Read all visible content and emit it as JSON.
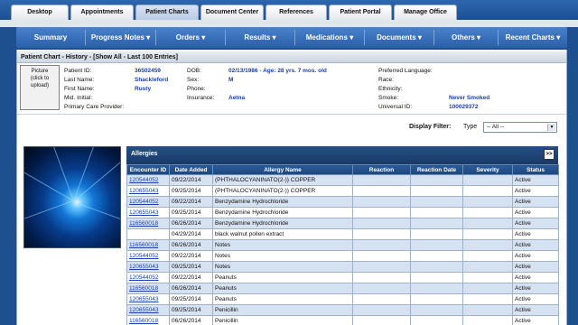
{
  "tabs": [
    "Desktop",
    "Appointments",
    "Patient Charts",
    "Document Center",
    "References",
    "Patient Portal",
    "Manage Office"
  ],
  "active_tab": "Patient Charts",
  "menu": [
    "Summary",
    "Progress Notes ▾",
    "Orders ▾",
    "Results ▾",
    "Medications ▾",
    "Documents ▾",
    "Others ▾",
    "Recent Charts ▾"
  ],
  "chart_title": "Patient Chart - History - [Show All - Last 100 Entries]",
  "picture": {
    "line1": "Picture",
    "line2": "(click to",
    "line3": "upload)"
  },
  "patient": {
    "id_label": "Patient ID:",
    "id": "36502459",
    "last_label": "Last Name:",
    "last": "Shackleford",
    "first_label": "First Name:",
    "first": "Rusty",
    "mid_label": "Mid. Initial:",
    "mid": "",
    "pcp_label": "Primary Care Provider:",
    "pcp": "",
    "dob_label": "DOB:",
    "dob": "02/13/1986 - Age: 28 yrs. 7 mos. old",
    "sex_label": "Sex:",
    "sex": "M",
    "phone_label": "Phone:",
    "phone": "",
    "ins_label": "Insurance:",
    "ins": "Aetna",
    "lang_label": "Preferred Language:",
    "lang": "",
    "race_label": "Race:",
    "race": "",
    "eth_label": "Ethnicity:",
    "eth": "",
    "smoke_label": "Smoke:",
    "smoke": "Never Smoked",
    "uid_label": "Universal ID:",
    "uid": "100029372"
  },
  "filter": {
    "label": "Display Filter:",
    "type_label": "Type",
    "selected": "-- All --"
  },
  "allergies": {
    "title": "Allergies",
    "expand_label": ">>",
    "columns": [
      "Encounter ID",
      "Date Added",
      "Allergy Name",
      "Reaction",
      "Reaction Date",
      "Severity",
      "Status"
    ],
    "rows": [
      [
        "120544052",
        "09/22/2014",
        "(PHTHALOCYANINATO(2-)) COPPER",
        "",
        "",
        "",
        "Active"
      ],
      [
        "120655043",
        "09/25/2014",
        "(PHTHALOCYANINATO(2-)) COPPER",
        "",
        "",
        "",
        "Active"
      ],
      [
        "120544052",
        "09/22/2014",
        "Benzydamine Hydrochloride",
        "",
        "",
        "",
        "Active"
      ],
      [
        "120655043",
        "09/25/2014",
        "Benzydamine Hydrochloride",
        "",
        "",
        "",
        "Active"
      ],
      [
        "116560018",
        "06/26/2014",
        "Benzydamine Hydrochloride",
        "",
        "",
        "",
        "Active"
      ],
      [
        "",
        "04/29/2014",
        "black walnut pollen extract",
        "",
        "",
        "",
        "Active"
      ],
      [
        "116560018",
        "06/26/2014",
        "Notes",
        "",
        "",
        "",
        "Active"
      ],
      [
        "120544052",
        "09/22/2014",
        "Notes",
        "",
        "",
        "",
        "Active"
      ],
      [
        "120655043",
        "09/25/2014",
        "Notes",
        "",
        "",
        "",
        "Active"
      ],
      [
        "120544052",
        "09/22/2014",
        "Peanuts",
        "",
        "",
        "",
        "Active"
      ],
      [
        "116560018",
        "06/26/2014",
        "Peanuts",
        "",
        "",
        "",
        "Active"
      ],
      [
        "120655043",
        "09/25/2014",
        "Peanuts",
        "",
        "",
        "",
        "Active"
      ],
      [
        "120655043",
        "09/25/2014",
        "Penicillin",
        "",
        "",
        "",
        "Active"
      ],
      [
        "116560018",
        "06/26/2014",
        "Penicillin",
        "",
        "",
        "",
        "Active"
      ]
    ]
  }
}
